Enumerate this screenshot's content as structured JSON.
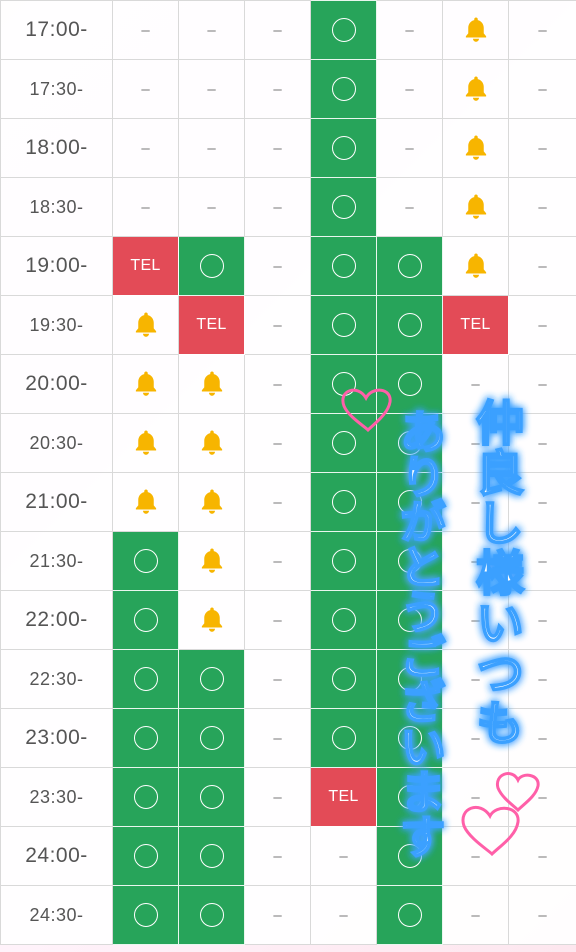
{
  "schedule": {
    "rows": [
      {
        "time": "17:00-",
        "cells": [
          "dash",
          "dash",
          "dash",
          "ok",
          "dash",
          "bell",
          "dash"
        ]
      },
      {
        "time": "17:30-",
        "cells": [
          "dash",
          "dash",
          "dash",
          "ok",
          "dash",
          "bell",
          "dash"
        ]
      },
      {
        "time": "18:00-",
        "cells": [
          "dash",
          "dash",
          "dash",
          "ok",
          "dash",
          "bell",
          "dash"
        ]
      },
      {
        "time": "18:30-",
        "cells": [
          "dash",
          "dash",
          "dash",
          "ok",
          "dash",
          "bell",
          "dash"
        ]
      },
      {
        "time": "19:00-",
        "cells": [
          "tel",
          "ok",
          "dash",
          "ok",
          "ok",
          "bell",
          "dash"
        ]
      },
      {
        "time": "19:30-",
        "cells": [
          "bell",
          "tel",
          "dash",
          "ok",
          "ok",
          "tel",
          "dash"
        ]
      },
      {
        "time": "20:00-",
        "cells": [
          "bell",
          "bell",
          "dash",
          "ok",
          "ok",
          "dash",
          "dash"
        ]
      },
      {
        "time": "20:30-",
        "cells": [
          "bell",
          "bell",
          "dash",
          "ok",
          "ok",
          "dash",
          "dash"
        ]
      },
      {
        "time": "21:00-",
        "cells": [
          "bell",
          "bell",
          "dash",
          "ok",
          "ok",
          "dash",
          "dash"
        ]
      },
      {
        "time": "21:30-",
        "cells": [
          "ok",
          "bell",
          "dash",
          "ok",
          "ok",
          "dash",
          "dash"
        ]
      },
      {
        "time": "22:00-",
        "cells": [
          "ok",
          "bell",
          "dash",
          "ok",
          "ok",
          "dash",
          "dash"
        ]
      },
      {
        "time": "22:30-",
        "cells": [
          "ok",
          "ok",
          "dash",
          "ok",
          "ok",
          "dash",
          "dash"
        ]
      },
      {
        "time": "23:00-",
        "cells": [
          "ok",
          "ok",
          "dash",
          "ok",
          "ok",
          "dash",
          "dash"
        ]
      },
      {
        "time": "23:30-",
        "cells": [
          "ok",
          "ok",
          "dash",
          "tel",
          "ok",
          "dash",
          "dash"
        ]
      },
      {
        "time": "24:00-",
        "cells": [
          "ok",
          "ok",
          "dash",
          "dash",
          "ok",
          "dash",
          "dash"
        ]
      },
      {
        "time": "24:30-",
        "cells": [
          "ok",
          "ok",
          "dash",
          "dash",
          "ok",
          "dash",
          "dash"
        ]
      }
    ],
    "labels": {
      "tel": "TEL",
      "dash": "–"
    }
  },
  "message": {
    "line1": "仲良し様いつも",
    "line2": "ありがとうございます"
  },
  "colors": {
    "available": "#27a45a",
    "tel": "#e34b57",
    "bell": "#f7b500",
    "message_glow": "#3aa0ff",
    "heart": "#ff69b4"
  }
}
